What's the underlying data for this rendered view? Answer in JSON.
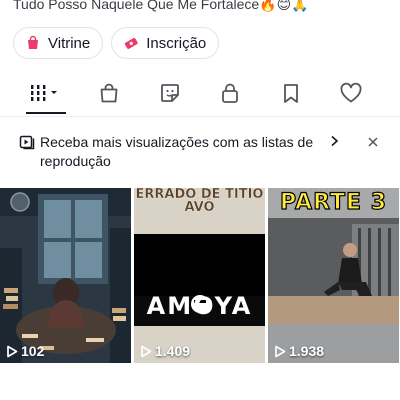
{
  "profile": {
    "bio": "Tudo Posso Naquele Que Me Fortalece🔥😊🙏"
  },
  "chips": [
    {
      "label": "Vitrine",
      "icon": "shopping-bag-icon",
      "color": "#e5245c"
    },
    {
      "label": "Inscrição",
      "icon": "ticket-icon",
      "color": "#e5245c"
    }
  ],
  "tabs": [
    {
      "name": "videos-grid",
      "icon": "grid-icon",
      "active": true
    },
    {
      "name": "shop",
      "icon": "shopping-bag-icon",
      "active": false
    },
    {
      "name": "reposts",
      "icon": "sticker-icon",
      "active": false
    },
    {
      "name": "private",
      "icon": "lock-icon",
      "active": false
    },
    {
      "name": "favorites",
      "icon": "bookmark-icon",
      "active": false
    },
    {
      "name": "liked",
      "icon": "heart-icon",
      "active": false
    }
  ],
  "banner": {
    "text": "Receba mais visualizações com as listas de reprodução",
    "icon": "playlist-icon"
  },
  "videos": [
    {
      "views": "102",
      "overlay_text": ""
    },
    {
      "views": "1.409",
      "overlay_title": "ERRADO DE TITIO AVÔ",
      "overlay_big": "AMOYA"
    },
    {
      "views": "1.938",
      "overlay_title": "PARTE 3"
    }
  ],
  "colors": {
    "accent": "#fe2c55",
    "text": "#161823",
    "divider": "#ececee"
  }
}
